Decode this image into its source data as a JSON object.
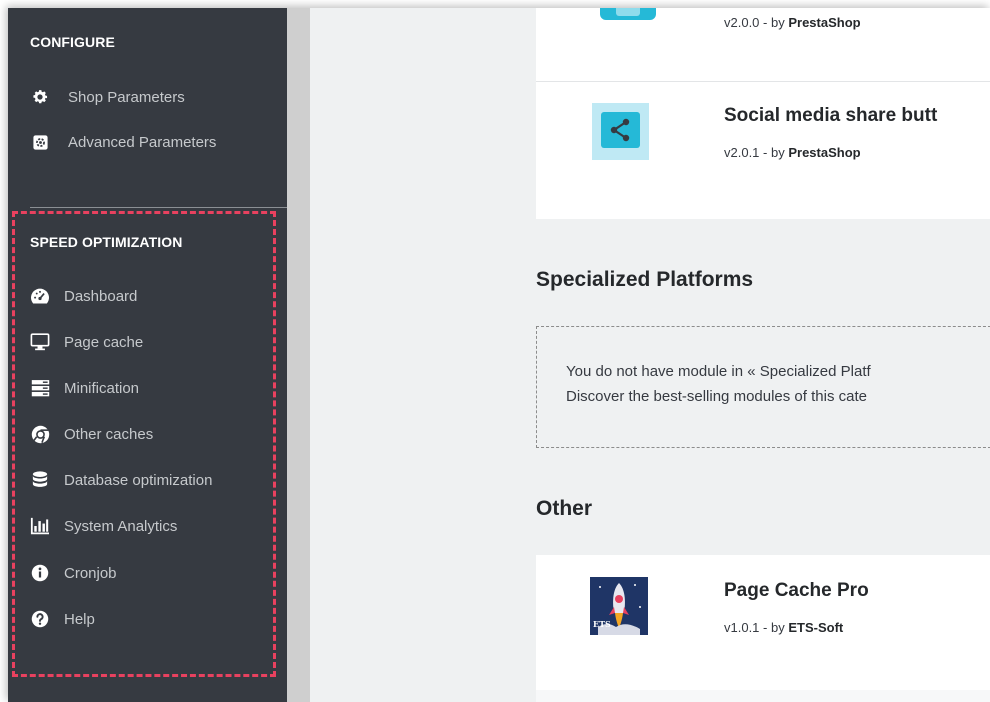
{
  "sidebar": {
    "configure": {
      "heading": "CONFIGURE",
      "items": [
        {
          "label": "Shop Parameters",
          "icon": "gear-icon"
        },
        {
          "label": "Advanced Parameters",
          "icon": "settings-box-icon"
        }
      ]
    },
    "speed": {
      "heading": "SPEED OPTIMIZATION",
      "items": [
        {
          "label": "Dashboard",
          "icon": "speedometer-icon"
        },
        {
          "label": "Page cache",
          "icon": "monitor-icon"
        },
        {
          "label": "Minification",
          "icon": "server-icon"
        },
        {
          "label": "Other caches",
          "icon": "chrome-icon"
        },
        {
          "label": "Database optimization",
          "icon": "database-icon"
        },
        {
          "label": "System Analytics",
          "icon": "bar-chart-icon"
        },
        {
          "label": "Cronjob",
          "icon": "info-icon"
        },
        {
          "label": "Help",
          "icon": "question-icon"
        }
      ]
    }
  },
  "main": {
    "modules": [
      {
        "title": "",
        "version": "v2.0.0",
        "by": "- by",
        "author": "PrestaShop"
      },
      {
        "title": "Social media share butt",
        "version": "v2.0.1",
        "by": "- by",
        "author": "PrestaShop"
      }
    ],
    "specialized": {
      "heading": "Specialized Platforms",
      "line1": "You do not have module in « Specialized Platf",
      "line2": "Discover the best-selling modules of this cate"
    },
    "other": {
      "heading": "Other",
      "module": {
        "title": "Page Cache Pro",
        "version": "v1.0.1",
        "by": "- by",
        "author": "ETS-Soft",
        "logo_text": "ETS"
      }
    }
  },
  "colors": {
    "sidebar_bg": "#363a41",
    "highlight_border": "#e8415f",
    "share_icon_bg": "#25b9d7",
    "main_bg": "#eff1f2"
  }
}
